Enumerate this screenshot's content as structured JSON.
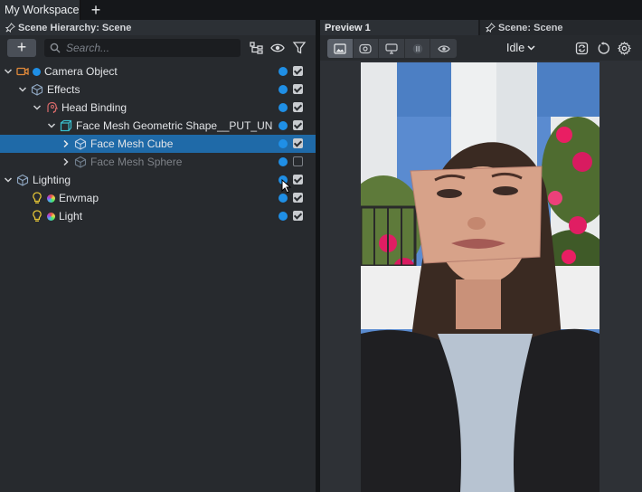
{
  "workspace": {
    "tab_label": "My Workspace",
    "add_tab": "+"
  },
  "hierarchy": {
    "panel_title": "Scene Hierarchy: Scene",
    "add_button": "+",
    "search_placeholder": "Search...",
    "rows": [
      {
        "label": "Camera Object",
        "icon": "camera-icon",
        "visible_toggle": true,
        "enabled": true
      },
      {
        "label": "Effects",
        "icon": "cube-icon",
        "visible_toggle": true,
        "enabled": true
      },
      {
        "label": "Head Binding",
        "icon": "head-binding-icon",
        "visible_toggle": true,
        "enabled": true
      },
      {
        "label": "Face Mesh Geometric Shape__PUT_UND",
        "icon": "mesh-box-icon",
        "visible_toggle": true,
        "enabled": true
      },
      {
        "label": "Face Mesh Cube",
        "icon": "cube-icon",
        "visible_toggle": true,
        "enabled": true,
        "selected": true
      },
      {
        "label": "Face Mesh Sphere",
        "icon": "cube-icon",
        "visible_toggle": true,
        "enabled": false
      },
      {
        "label": "Lighting",
        "icon": "cube-icon",
        "visible_toggle": true,
        "enabled": true
      },
      {
        "label": "Envmap",
        "icon": "light-bulb-icon",
        "visible_toggle": true,
        "enabled": true
      },
      {
        "label": "Light",
        "icon": "light-bulb-icon",
        "visible_toggle": true,
        "enabled": true
      }
    ]
  },
  "preview": {
    "tab_label": "Preview 1",
    "scene_tab_label": "Scene: Scene",
    "state_dropdown": "Idle"
  },
  "colors": {
    "selection": "#1f6aa8",
    "toggle_dot": "#1f8fe6",
    "camera_orange": "#e0893a",
    "bulb_yellow": "#e3c436"
  }
}
